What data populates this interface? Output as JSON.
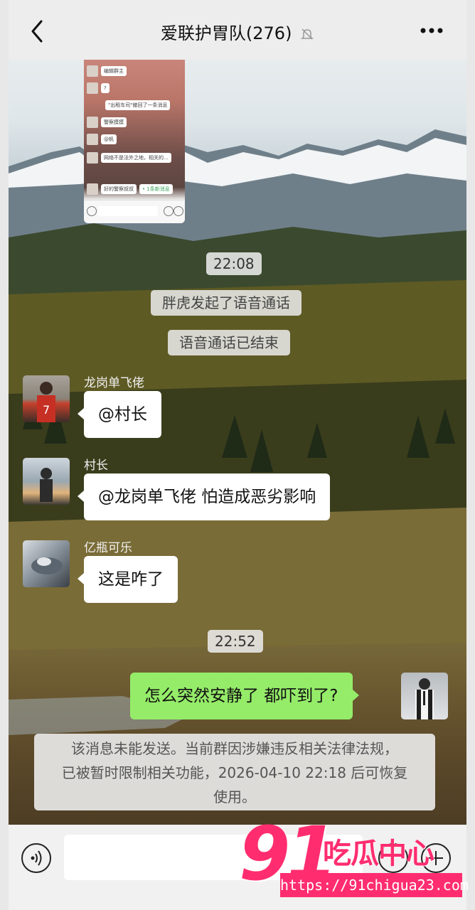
{
  "header": {
    "title": "爱联护胃队(276)",
    "back_icon": "chevron-left-icon",
    "mute_icon": "bell-off-icon",
    "more_icon": "more-dots-icon"
  },
  "messages": {
    "time1": "22:08",
    "sys1": "胖虎发起了语音通话",
    "sys2": "语音通话已结束",
    "m1": {
      "name": "龙岗单飞佬",
      "text": "@村长"
    },
    "m2": {
      "name": "村长",
      "text": "@龙岗单飞佬 怕造成恶劣影响"
    },
    "m3": {
      "name": "亿瓶可乐",
      "text": "这是咋了"
    },
    "time2": "22:52",
    "me": {
      "text": "怎么突然安静了 都吓到了?"
    },
    "notice_lines": [
      "该消息未能发送。当前群因涉嫌违反相关法律法规，",
      "已被暂时限制相关功能，2026-04-10 22:18 后可恢复",
      "使用。"
    ]
  },
  "thumbnail": {
    "rows": [
      "编辑群主",
      "?",
      "\"出租车司\"撤回了一条消息",
      "警察摸摸",
      "@帆",
      "网络不是法外之地，相关的...",
      "好的警察叔叔",
      "• 1条新消息"
    ]
  },
  "watermark": {
    "number": "91",
    "chinese": "吃瓜中心",
    "url": "https://91chigua23.com"
  },
  "colors": {
    "my_bubble": "#95ec69",
    "watermark": "#ff2d6f"
  }
}
